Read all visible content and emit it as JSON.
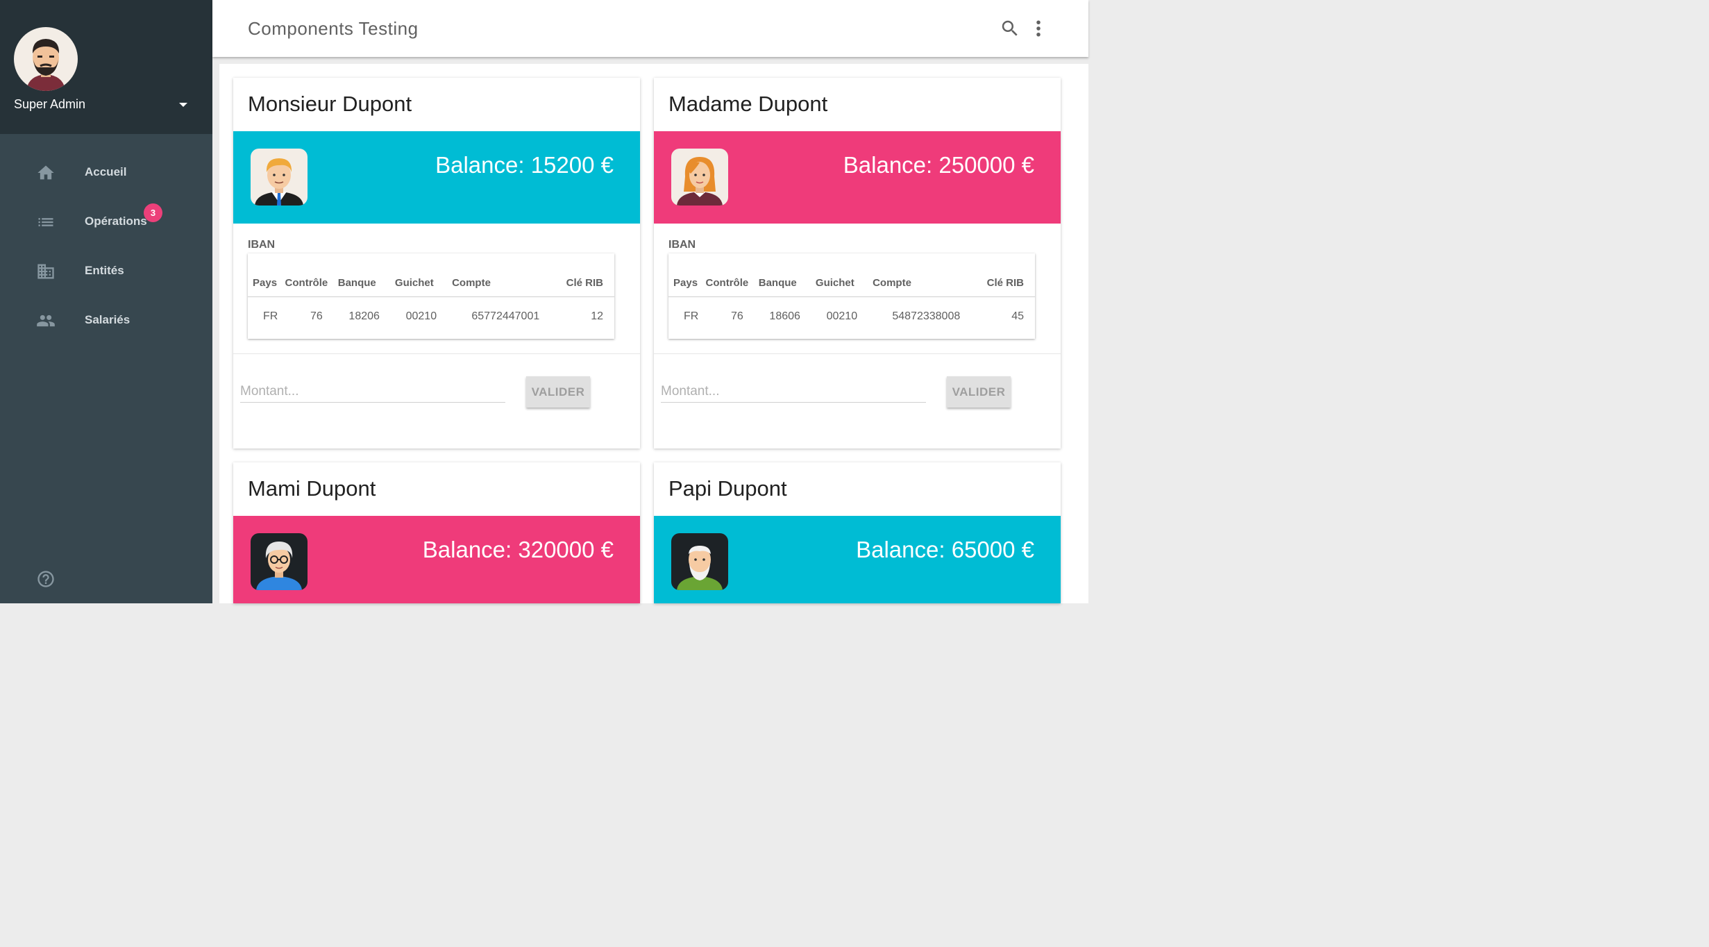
{
  "colors": {
    "cyan": "#00bcd4",
    "pink": "#ef3b7a",
    "sidebar": "#37474f",
    "sidebar_head": "#263238",
    "badge": "#ec407a"
  },
  "sidebar": {
    "user_name": "Super Admin",
    "items": [
      {
        "label": "Accueil",
        "icon": "home-icon"
      },
      {
        "label": "Opérations",
        "icon": "list-icon",
        "badge": "3"
      },
      {
        "label": "Entités",
        "icon": "building-icon"
      },
      {
        "label": "Salariés",
        "icon": "people-icon"
      }
    ],
    "help_icon": "help-icon"
  },
  "header": {
    "title": "Components Testing",
    "search_icon": "search-icon",
    "menu_icon": "more-vert-icon"
  },
  "iban_columns": [
    "Pays",
    "Contrôle",
    "Banque",
    "Guichet",
    "Compte",
    "Clé RIB"
  ],
  "cards": [
    {
      "name": "Monsieur Dupont",
      "balance": "Balance: 15200 €",
      "color": "cyan",
      "iban_label": "IBAN",
      "iban": {
        "pays": "FR",
        "controle": "76",
        "banque": "18206",
        "guichet": "00210",
        "compte": "65772447001",
        "cle": "12"
      },
      "amount_placeholder": "Montant...",
      "button": "VALIDER"
    },
    {
      "name": "Madame Dupont",
      "balance": "Balance: 250000 €",
      "color": "pink",
      "iban_label": "IBAN",
      "iban": {
        "pays": "FR",
        "controle": "76",
        "banque": "18606",
        "guichet": "00210",
        "compte": "54872338008",
        "cle": "45"
      },
      "amount_placeholder": "Montant...",
      "button": "VALIDER"
    },
    {
      "name": "Mami Dupont",
      "balance": "Balance: 320000 €",
      "color": "pink"
    },
    {
      "name": "Papi Dupont",
      "balance": "Balance: 65000 €",
      "color": "cyan"
    }
  ]
}
